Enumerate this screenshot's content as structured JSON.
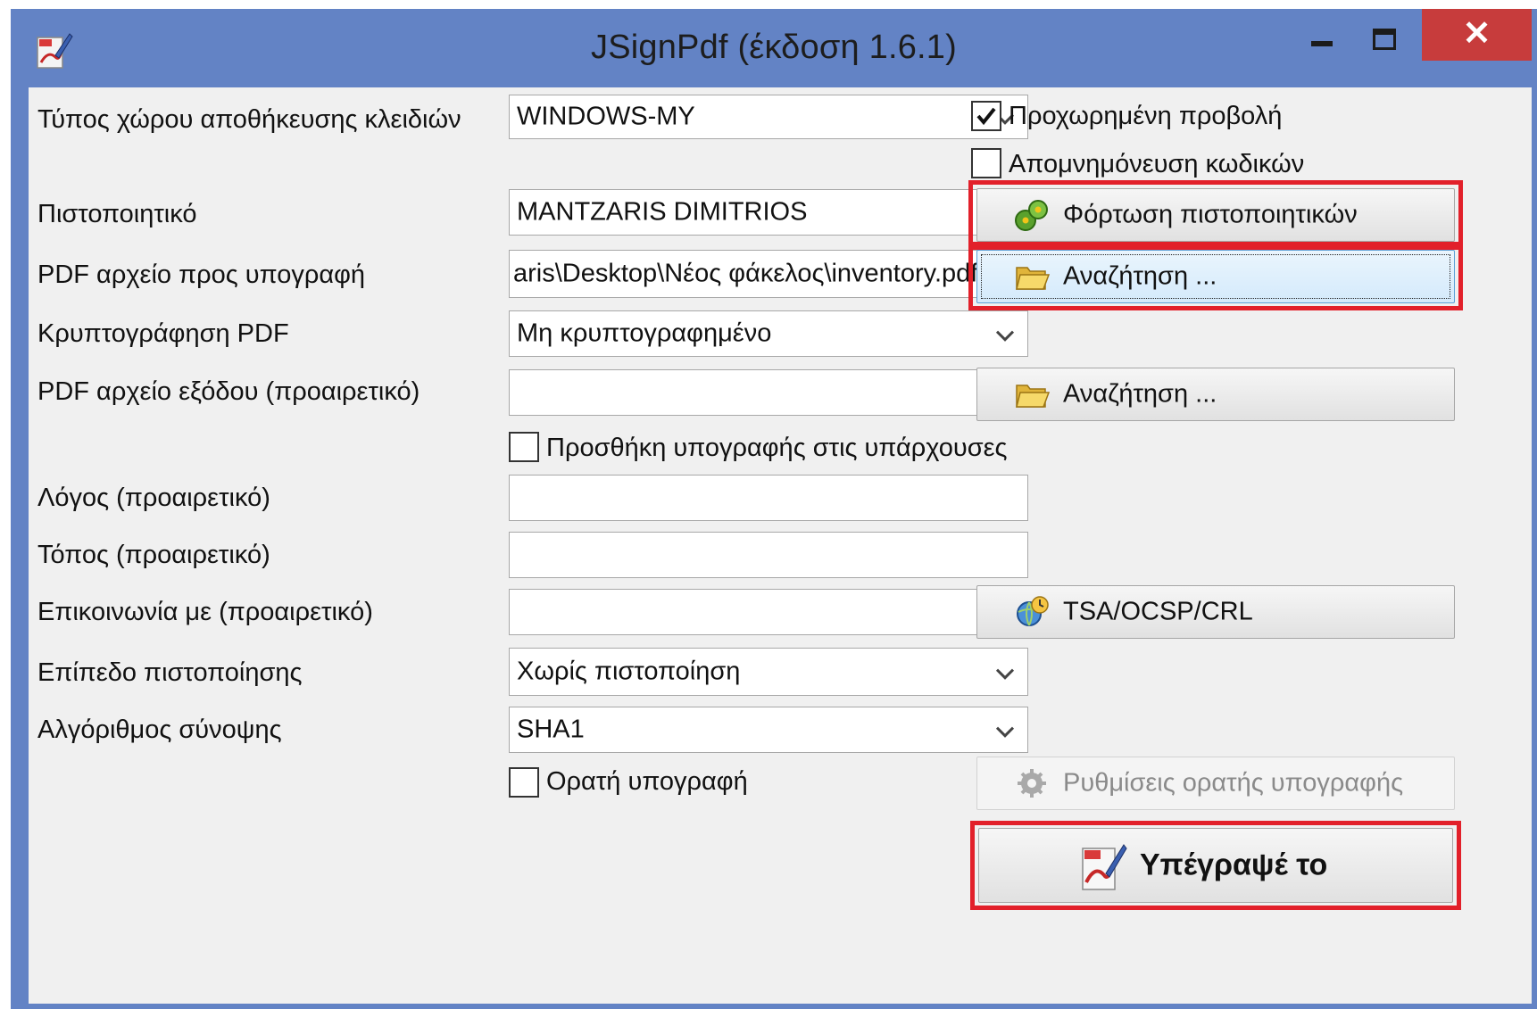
{
  "window": {
    "title": "JSignPdf (έκδοση 1.6.1)",
    "close_symbol": "✕"
  },
  "form": {
    "keystore_type": {
      "label": "Τύπος χώρου αποθήκευσης κλειδιών",
      "value": "WINDOWS-MY"
    },
    "advanced_view": {
      "label": "Προχωρημένη προβολή",
      "checked": true
    },
    "remember_passwords": {
      "label": "Απομνημόνευση κωδικών",
      "checked": false
    },
    "certificate": {
      "label": "Πιστοποιητικό",
      "value": "MANTZARIS DIMITRIOS"
    },
    "load_certificates_button": "Φόρτωση πιστοποιητικών",
    "input_pdf": {
      "label": "PDF αρχείο προς υπογραφή",
      "value": "aris\\Desktop\\Νέος φάκελος\\inventory.pdf"
    },
    "browse_input_button": "Αναζήτηση ...",
    "pdf_encryption": {
      "label": "Κρυπτογράφηση PDF",
      "value": "Μη κρυπτογραφημένο"
    },
    "output_pdf": {
      "label": "PDF αρχείο εξόδου (προαιρετικό)",
      "value": ""
    },
    "browse_output_button": "Αναζήτηση ...",
    "append_signature": {
      "label": "Προσθήκη υπογραφής στις υπάρχουσες",
      "checked": false
    },
    "reason": {
      "label": "Λόγος (προαιρετικό)",
      "value": ""
    },
    "location": {
      "label": "Τόπος (προαιρετικό)",
      "value": ""
    },
    "contact": {
      "label": "Επικοινωνία με (προαιρετικό)",
      "value": ""
    },
    "tsa_button": "TSA/OCSP/CRL",
    "certification_level": {
      "label": "Επίπεδο πιστοποίησης",
      "value": "Χωρίς πιστοποίηση"
    },
    "hash_algorithm": {
      "label": "Αλγόριθμος σύνοψης",
      "value": "SHA1"
    },
    "visible_signature": {
      "label": "Ορατή υπογραφή",
      "checked": false
    },
    "visible_signature_settings_button": "Ρυθμίσεις ορατής υπογραφής",
    "sign_button": "Υπέγραψέ το"
  },
  "colors": {
    "title_bar": "#6383c5",
    "close_button": "#c73c3c",
    "highlight_box": "#e2202a",
    "client_background": "#f0f0f0"
  },
  "icons": {
    "app": "pdf-pen-icon",
    "load_certificates": "key-gear-icon",
    "browse": "folder-icon",
    "tsa": "clock-globe-icon",
    "settings": "gear-icon",
    "sign": "pdf-pen-icon"
  }
}
